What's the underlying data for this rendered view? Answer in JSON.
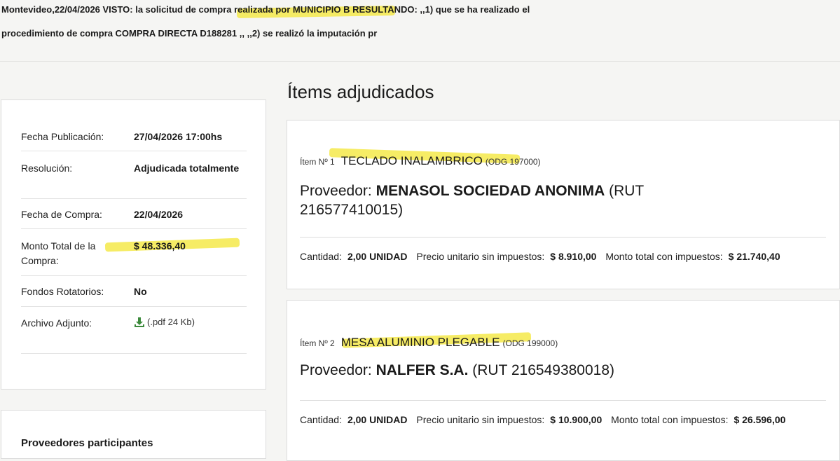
{
  "description": {
    "line1": "Montevideo,22/04/2026 VISTO: la solicitud de compra realizada por MUNICIPIO B RESULTANDO: ,,1) que se ha realizado el",
    "line2": "procedimiento de compra COMPRA DIRECTA D188281 ,, ,,2) se realizó la imputación pr"
  },
  "info": {
    "rows": [
      {
        "label": "Fecha Publicación:",
        "value": "27/04/2026 17:00hs"
      },
      {
        "label": "Resolución:",
        "value": "Adjudicada totalmente"
      },
      {
        "label": "Fecha de Compra:",
        "value": "22/04/2026"
      },
      {
        "label": "Monto Total de la Compra:",
        "value": "$ 48.336,40"
      },
      {
        "label": "Fondos Rotatorios:",
        "value": "No"
      },
      {
        "label": "Archivo Adjunto:",
        "value": "(.pdf 24 Kb)"
      }
    ],
    "attachment_icon": "download-icon"
  },
  "providers": {
    "title": "Proveedores participantes"
  },
  "awarded": {
    "title": "Ítems adjudicados",
    "items": [
      {
        "number": "Ítem Nº 1",
        "name": "TECLADO INALAMBRICO",
        "odg": "(ODG 197000)",
        "provider_prefix": "Proveedor:",
        "provider_name": "MENASOL SOCIEDAD ANONIMA",
        "provider_rut": "(RUT 216577410015)",
        "quantity_label": "Cantidad:",
        "quantity_value": "2,00 UNIDAD",
        "unit_price_label": "Precio unitario sin impuestos:",
        "unit_price_value": "$ 8.910,00",
        "total_label": "Monto total con impuestos:",
        "total_value": "$ 21.740,40"
      },
      {
        "number": "Ítem Nº 2",
        "name": "MESA ALUMINIO PLEGABLE",
        "odg": "(ODG 199000)",
        "provider_prefix": "Proveedor:",
        "provider_name": "NALFER S.A.",
        "provider_rut": "(RUT 216549380018)",
        "quantity_label": "Cantidad:",
        "quantity_value": "2,00 UNIDAD",
        "unit_price_label": "Precio unitario sin impuestos:",
        "unit_price_value": "$ 10.900,00",
        "total_label": "Monto total con impuestos:",
        "total_value": "$ 26.596,00"
      }
    ]
  },
  "colors": {
    "highlighter": "#f4e94a",
    "background": "#f5f5f3",
    "card": "#ffffff",
    "download_icon": "#3c8a3c"
  }
}
